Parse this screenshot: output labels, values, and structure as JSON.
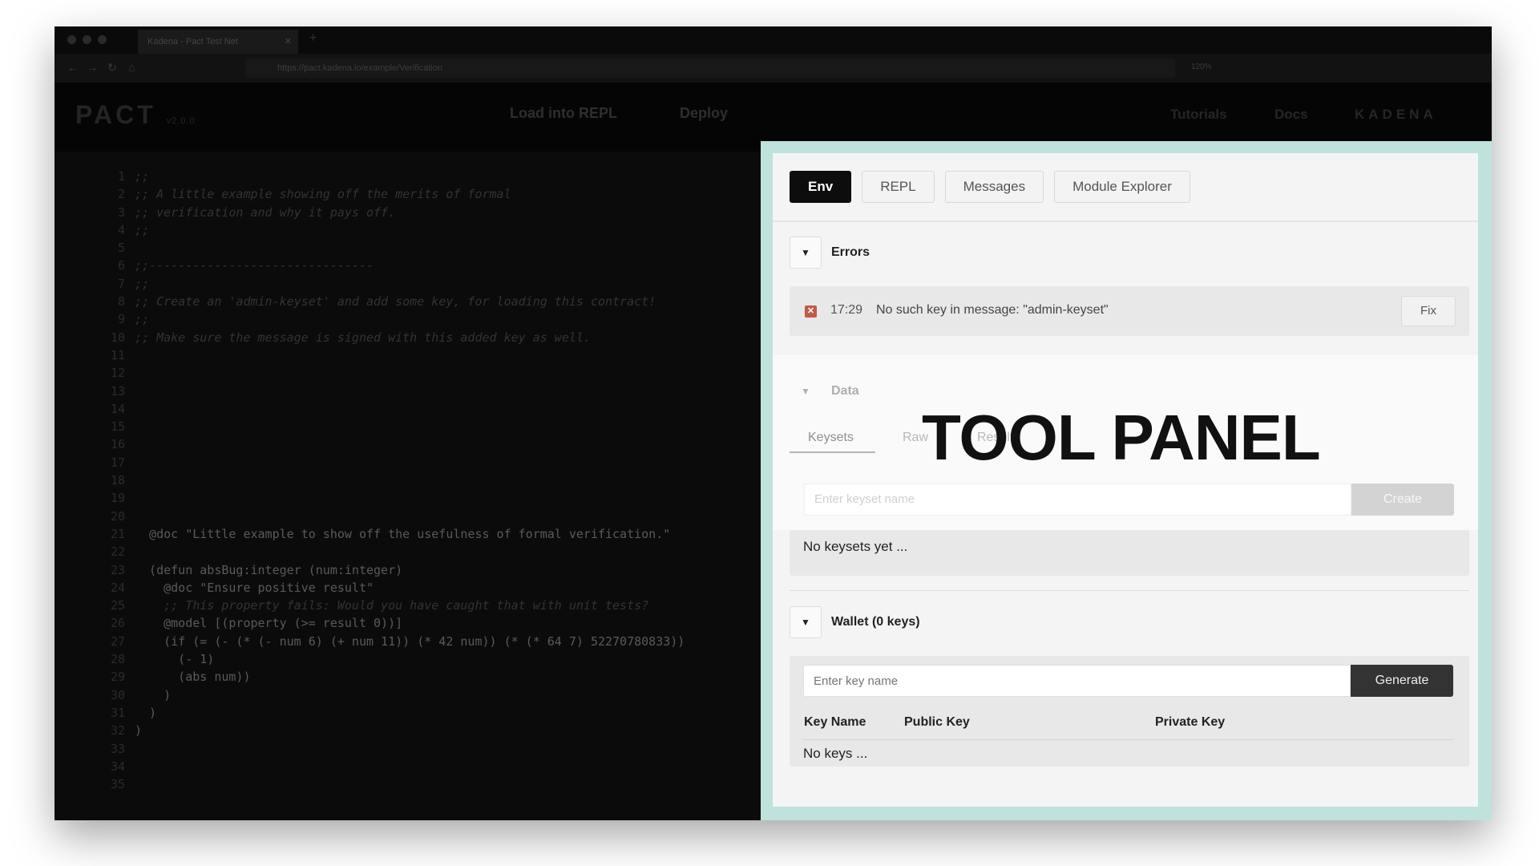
{
  "browser": {
    "tab_title": "Kadena - Pact Test Net",
    "tab_close": "✕",
    "new_tab": "+",
    "url": "https://pact.kadena.io/example/Verification",
    "zoom": "120%"
  },
  "app_header": {
    "logo": "PACT",
    "logo_version": "v2.0.0",
    "load_button": "Load into REPL",
    "deploy_button": "Deploy",
    "tutorials_link": "Tutorials",
    "docs_link": "Docs",
    "brand": "KADENA"
  },
  "editor": {
    "line_numbers": [
      "1",
      "2",
      "3",
      "4",
      "5",
      "6",
      "7",
      "8",
      "9",
      "10",
      "11",
      "12",
      "13",
      "14",
      "15",
      "16",
      "17",
      "18",
      "19",
      "20",
      "21",
      "22",
      "23",
      "24",
      "25",
      "26",
      "27",
      "28",
      "29",
      "30",
      "31",
      "32",
      "33",
      "34",
      "35"
    ],
    "lines": [
      ";;",
      ";; A little example showing off the merits of formal",
      ";; verification and why it pays off.",
      ";;",
      "",
      ";;-------------------------------",
      ";;",
      ";; Create an 'admin-keyset' and add some key, for loading this contract!",
      ";;",
      ";; Make sure the message is signed with this added key as well.",
      "",
      "",
      "",
      "",
      "",
      "",
      "",
      "",
      "",
      "",
      "  @doc \"Little example to show off the usefulness of formal verification.\"",
      "",
      "  (defun absBug:integer (num:integer)",
      "    @doc \"Ensure positive result\"",
      "    ;; This property fails: Would you have caught that with unit tests?",
      "    @model [(property (>= result 0))]",
      "    (if (= (- (* (- num 6) (+ num 11)) (* 42 num)) (* (* 64 7) 52270780833))",
      "      (- 1)",
      "      (abs num))",
      "    )",
      "  )",
      ")",
      "",
      "",
      ""
    ]
  },
  "panel": {
    "tabs": [
      "Env",
      "REPL",
      "Messages",
      "Module Explorer"
    ],
    "active_tab": "Env",
    "errors": {
      "title": "Errors",
      "time": "17:29",
      "message": "No such key in message: \"admin-keyset\"",
      "fix_button": "Fix"
    },
    "data": {
      "title": "Data",
      "subtabs": [
        "Keysets",
        "Raw",
        "Result"
      ],
      "keyset_placeholder": "Enter keyset name",
      "create_button": "Create",
      "empty": "No keysets yet ..."
    },
    "wallet": {
      "title": "Wallet (0 keys)",
      "key_placeholder": "Enter key name",
      "generate_button": "Generate",
      "columns": [
        "Key Name",
        "Public Key",
        "Private Key"
      ],
      "empty": "No keys ..."
    }
  },
  "overlay_label": "TOOL PANEL"
}
